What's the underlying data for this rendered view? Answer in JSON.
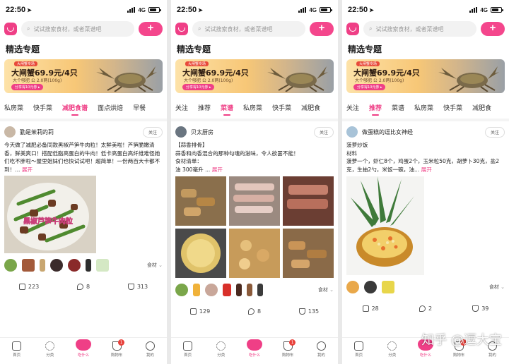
{
  "status": {
    "time": "22:50",
    "network": "4G"
  },
  "search": {
    "placeholder": "试试搜索食材，或者菜谱吧",
    "add_label": "+"
  },
  "section_title": "精选专题",
  "banner": {
    "tag": "大闸蟹专场",
    "headline": "大闸蟹69.9元/4只",
    "sub": "大个够肥 公 2.0两(100g)",
    "share": "分享得10元券 ▸"
  },
  "screens": [
    {
      "tabs": [
        "私房菜",
        "快手菜",
        "减肥食谱",
        "面点烘焙",
        "早餐"
      ],
      "active_tab": 2,
      "post": {
        "author": "勤是茉莉的莉",
        "follow": "关注",
        "text": "今天做了减肥必备同款黑椒芦笋牛肉粒！太鲜美啦！芦笋脆嫩清香，鲜美爽口！搭配低脂高蛋白的牛肉！低卡高蛋白高纤维难怪她们吃不胖啦～屋里姐妹们也快试试吧！超简单！一份两百大卡都不到！...",
        "more": "展开",
        "image_caption": "黑椒芦笋牛肉粒",
        "ingredients_label": "食材",
        "likes": "313",
        "comments": "8",
        "shares": "223"
      }
    },
    {
      "tabs": [
        "关注",
        "推荐",
        "菜谱",
        "私房菜",
        "快手菜",
        "减肥食"
      ],
      "active_tab": 2,
      "post": {
        "author": "贝太厨房",
        "follow": "关注",
        "text_title": "【蒜香排骨】",
        "text": "蒜香和肉香混合的那种勾魂的滋味，令人欲罢不能！",
        "ingredients_title": "食材清单：",
        "ingredients_line": "油  300毫升 ...",
        "more": "展开",
        "ingredients_label": "食材",
        "likes": "135",
        "comments": "8",
        "shares": "129"
      }
    },
    {
      "tabs": [
        "关注",
        "推荐",
        "菜谱",
        "私房菜",
        "快手菜",
        "减肥食"
      ],
      "active_tab": 1,
      "post": {
        "author": "做蛋糕的逗比女神经",
        "follow": "关注",
        "text_title": "菠萝炒饭",
        "ingredients_title": "材料",
        "text": "菠萝一个，虾仁8个，鸡蛋2个，玉米粒50克，胡萝卜30克，盐2克，生抽2勺，米饭一碗，油...",
        "more": "展开",
        "ingredients_label": "食材",
        "likes": "39",
        "comments": "2",
        "shares": "28"
      }
    }
  ],
  "nav": [
    "首页",
    "分类",
    "吃什么",
    "购物车",
    "我的"
  ],
  "cart_badge": "1",
  "watermark": "知乎 @逗大宝",
  "colors": {
    "accent": "#ef3f86",
    "badge": "#e8403a"
  }
}
